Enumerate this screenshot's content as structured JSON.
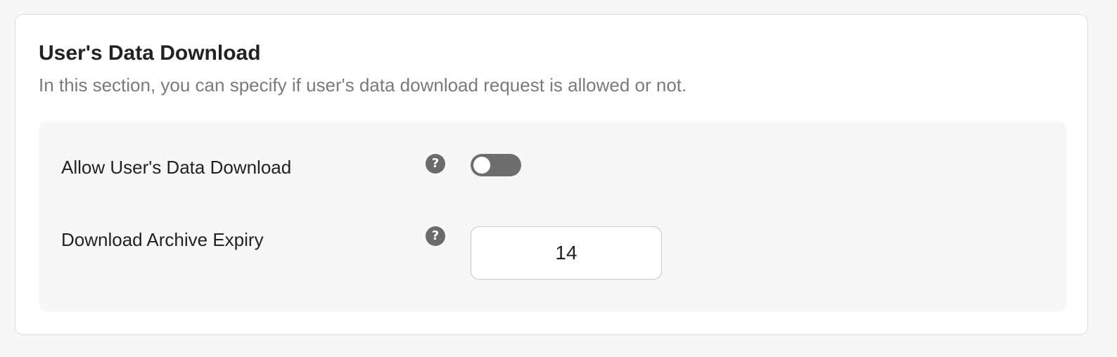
{
  "section": {
    "title": "User's Data Download",
    "description": "In this section, you can specify if user's data download request is allowed or not."
  },
  "settings": {
    "allow_download": {
      "label": "Allow User's Data Download",
      "help_icon": "question-circle-icon",
      "help_glyph": "?",
      "enabled": false
    },
    "archive_expiry": {
      "label": "Download Archive Expiry",
      "help_icon": "question-circle-icon",
      "help_glyph": "?",
      "value": "14"
    }
  },
  "colors": {
    "toggle_off": "#6e6e6e",
    "panel_background": "#f7f7f7",
    "card_border": "#dedede"
  }
}
